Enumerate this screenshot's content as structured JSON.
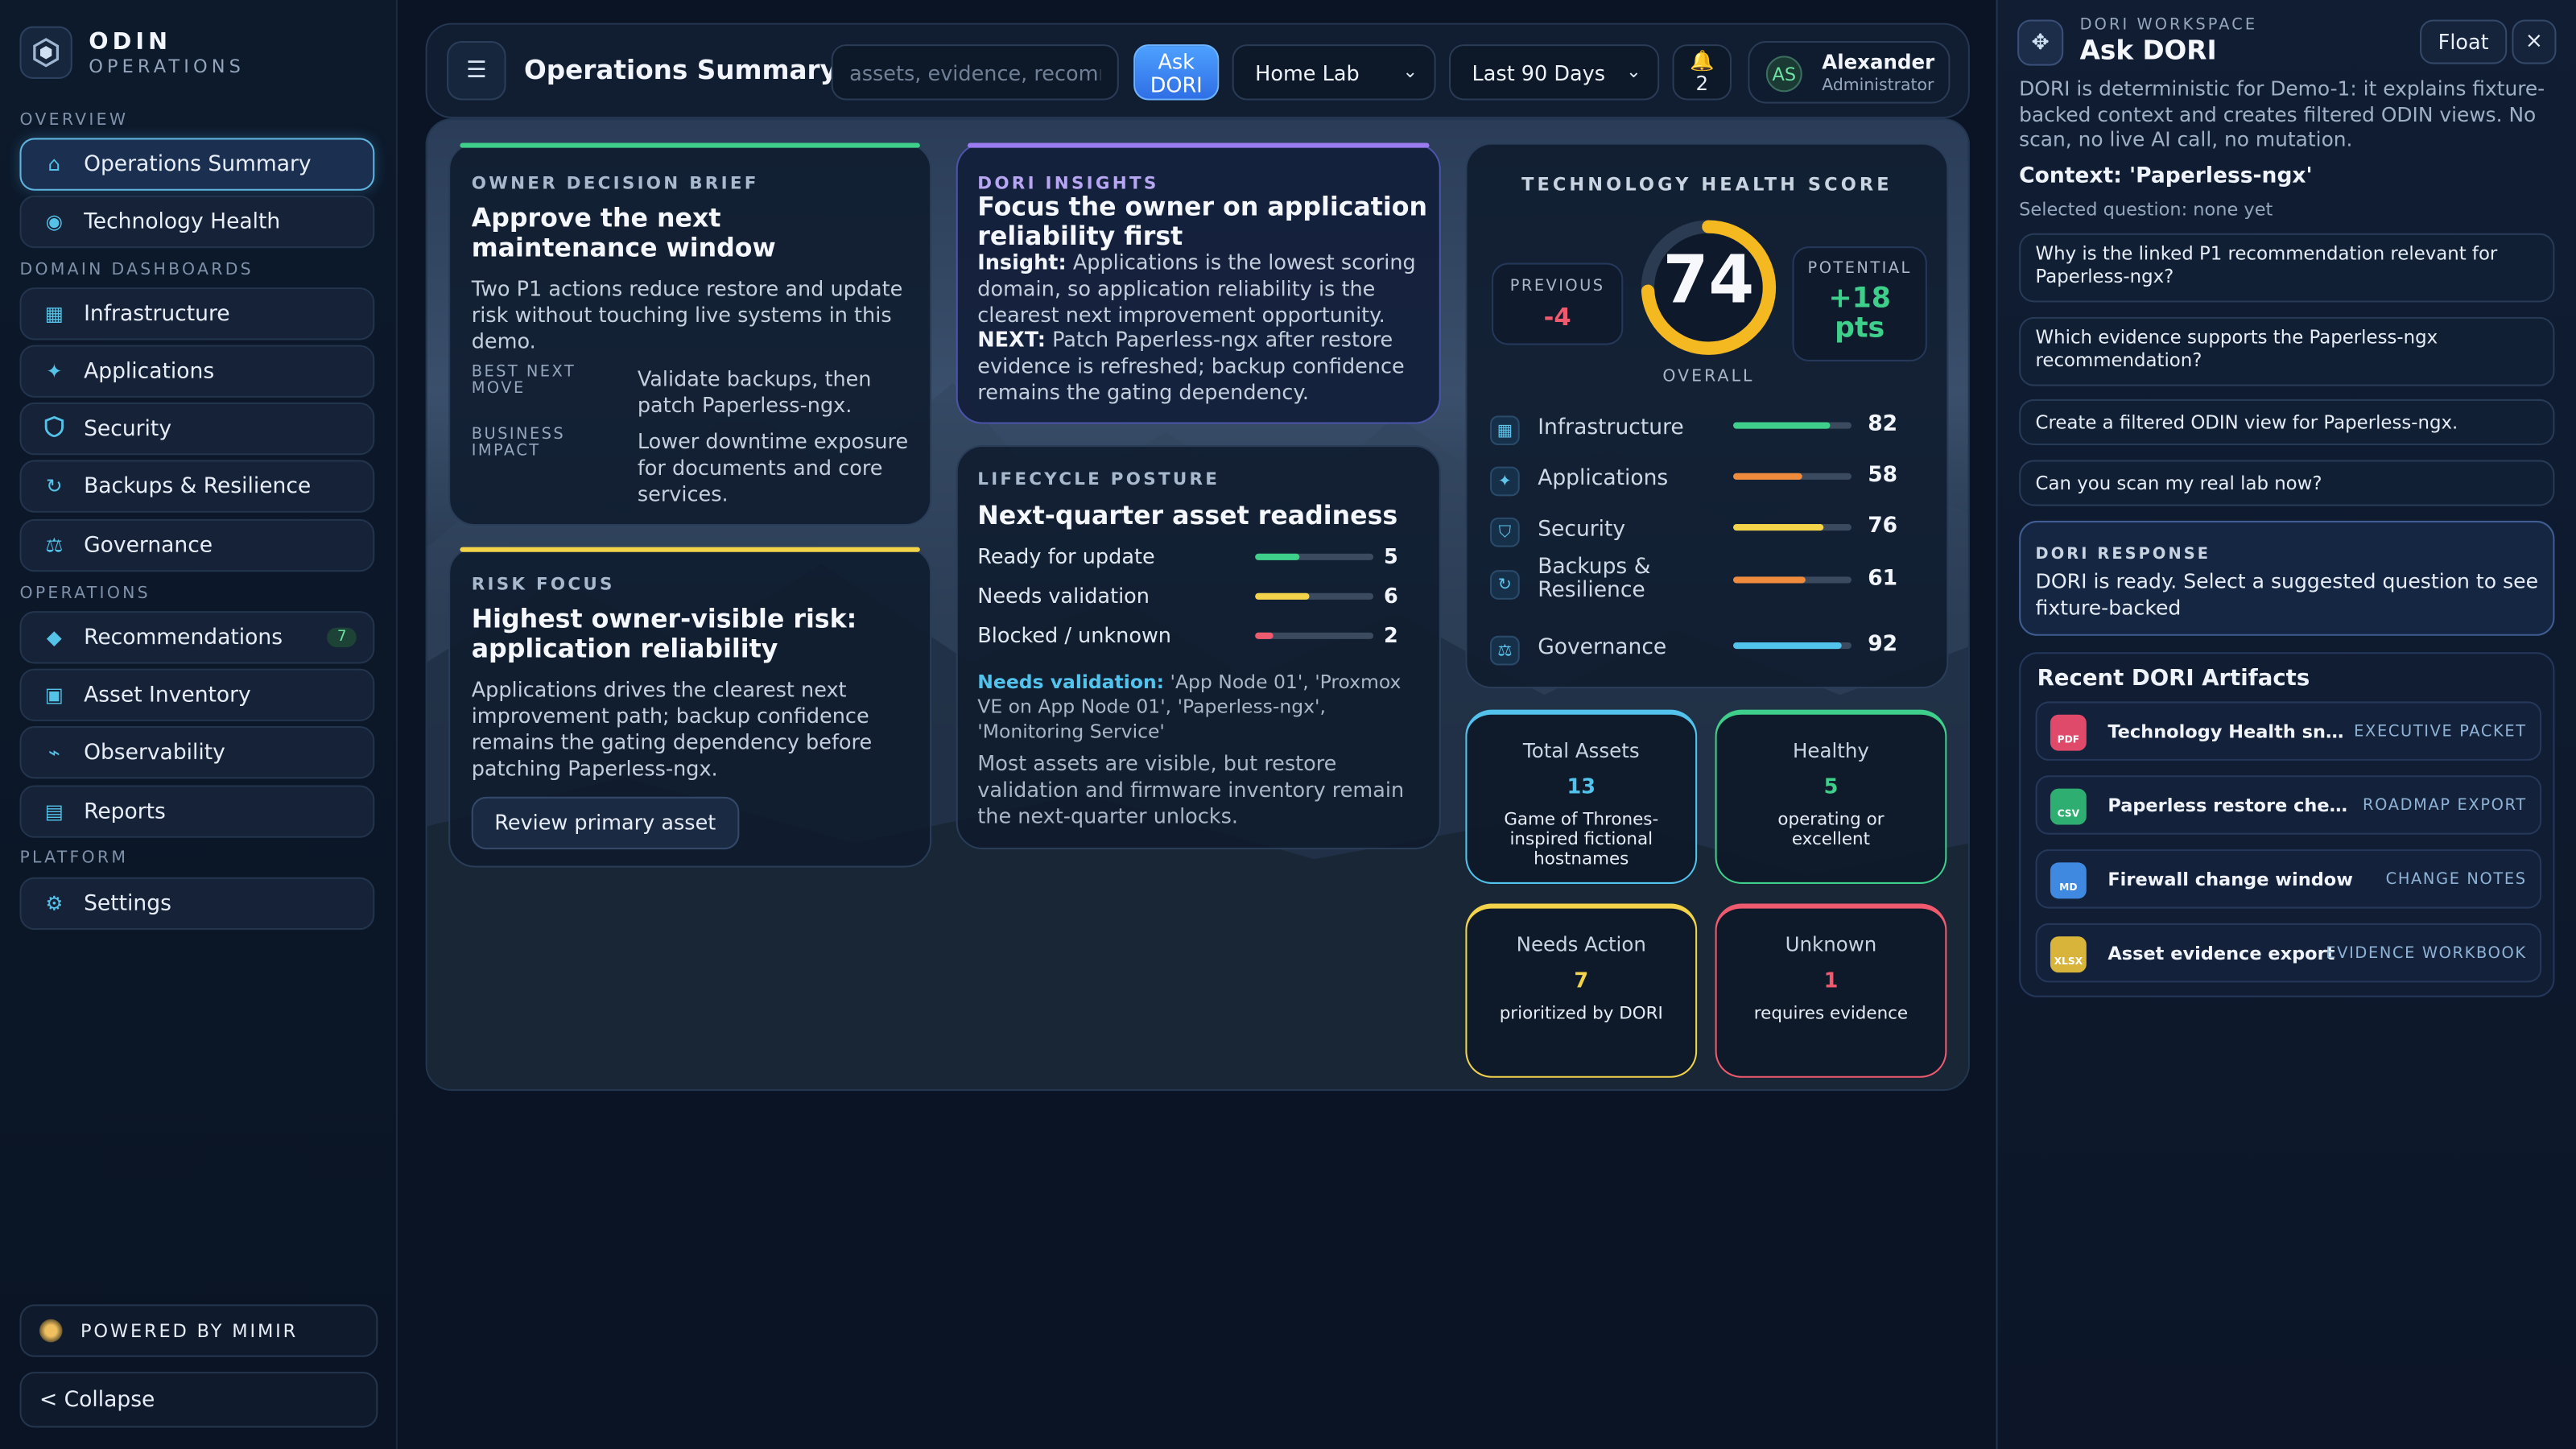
{
  "brand": {
    "name": "ODIN",
    "sub": "OPERATIONS"
  },
  "sections": {
    "overview": "OVERVIEW",
    "domain": "DOMAIN DASHBOARDS",
    "operations": "OPERATIONS",
    "platform": "PLATFORM"
  },
  "nav": {
    "overview": [
      {
        "label": "Operations Summary",
        "icon": "home-icon"
      },
      {
        "label": "Technology Health",
        "icon": "pulse-icon"
      }
    ],
    "domain": [
      {
        "label": "Infrastructure",
        "icon": "server-icon"
      },
      {
        "label": "Applications",
        "icon": "sparkle-icon"
      },
      {
        "label": "Security",
        "icon": "shield-icon"
      },
      {
        "label": "Backups & Resilience",
        "icon": "refresh-icon"
      },
      {
        "label": "Governance",
        "icon": "scale-icon"
      }
    ],
    "operations": [
      {
        "label": "Recommendations",
        "icon": "diamond-icon",
        "badge": "7"
      },
      {
        "label": "Asset Inventory",
        "icon": "box-icon"
      },
      {
        "label": "Observability",
        "icon": "wave-icon"
      },
      {
        "label": "Reports",
        "icon": "report-icon"
      }
    ],
    "platform": [
      {
        "label": "Settings",
        "icon": "gear-icon"
      }
    ]
  },
  "powered": "POWERED BY MIMIR",
  "collapse": "< Collapse",
  "header": {
    "title": "Operations Summary",
    "search_placeholder": "assets, evidence, recommendations",
    "ask_line1": "Ask",
    "ask_line2": "DORI",
    "site": "Home Lab",
    "range": "Last 90 Days",
    "bell_count": "2",
    "user_initials": "AS",
    "user_name": "Alexander",
    "user_role": "Administrator"
  },
  "owner": {
    "kicker": "OWNER DECISION BRIEF",
    "title": "Approve the next maintenance window",
    "text": "Two P1 actions reduce restore and update risk without touching live systems in this demo.",
    "k1": "BEST NEXT MOVE",
    "v1": "Validate backups, then patch Paperless-ngx.",
    "k2": "BUSINESS IMPACT",
    "v2": "Lower downtime exposure for documents and core services."
  },
  "risk": {
    "kicker": "RISK FOCUS",
    "title": "Highest owner-visible risk: application reliability",
    "text": "Applications drives the clearest next improvement path; backup confidence remains the gating dependency before patching Paperless-ngx.",
    "button": "Review primary asset"
  },
  "insights": {
    "kicker": "DORI INSIGHTS",
    "title": "Focus the owner on application reliability first",
    "insight_label": "Insight:",
    "insight": "Applications is the lowest scoring domain, so application reliability is the clearest next improvement opportunity.",
    "next_label": "NEXT:",
    "next": "Patch Paperless-ngx after restore evidence is refreshed; backup confidence remains the gating dependency."
  },
  "lifecycle": {
    "kicker": "LIFECYCLE POSTURE",
    "title": "Next-quarter asset readiness",
    "rows": [
      {
        "label": "Ready for update",
        "value": "5",
        "fraction": 0.38,
        "color": "#3ed08a"
      },
      {
        "label": "Needs validation",
        "value": "6",
        "fraction": 0.46,
        "color": "#f2d34a"
      },
      {
        "label": "Blocked / unknown",
        "value": "2",
        "fraction": 0.15,
        "color": "#ef5a6f"
      }
    ],
    "nv_label": "Needs validation:",
    "nv_text": "'App Node 01', 'Proxmox VE on App Node 01', 'Paperless-ngx', 'Monitoring Service'",
    "note": "Most assets are visible, but restore validation and firmware inventory remain the next-quarter unlocks."
  },
  "health": {
    "kicker": "TECHNOLOGY HEALTH SCORE",
    "score": "74",
    "score_fraction": 0.74,
    "overall": "OVERALL",
    "prev_label": "PREVIOUS",
    "prev": "-4",
    "pot_label": "POTENTIAL",
    "pot": "+18",
    "pot_unit": "pts",
    "domains": [
      {
        "name": "Infrastructure",
        "value": "82",
        "fraction": 0.82,
        "color": "#3ed08a",
        "icon": "server-icon"
      },
      {
        "name": "Applications",
        "value": "58",
        "fraction": 0.58,
        "color": "#f08a3c",
        "icon": "sparkle-icon"
      },
      {
        "name": "Security",
        "value": "76",
        "fraction": 0.76,
        "color": "#f2d34a",
        "icon": "shield-icon"
      },
      {
        "name": "Backups & Resilience",
        "value": "61",
        "fraction": 0.61,
        "color": "#f08a3c",
        "icon": "refresh-icon"
      },
      {
        "name": "Governance",
        "value": "92",
        "fraction": 0.92,
        "color": "#52c3ec",
        "icon": "scale-icon"
      }
    ]
  },
  "stats": [
    {
      "label": "Total Assets",
      "value": "13",
      "desc": "Game of Thrones-inspired fictional hostnames",
      "color": "#52c3ec",
      "vcolor": "#52c3ec"
    },
    {
      "label": "Healthy",
      "value": "5",
      "desc": "operating or excellent",
      "color": "#3ed08a",
      "vcolor": "#3ed08a"
    },
    {
      "label": "Needs Action",
      "value": "7",
      "desc": "prioritized by DORI",
      "color": "#f2d34a",
      "vcolor": "#f2d34a"
    },
    {
      "label": "Unknown",
      "value": "1",
      "desc": "requires evidence",
      "color": "#ef5a6f",
      "vcolor": "#ef5a6f"
    }
  ],
  "dori": {
    "kicker": "DORI WORKSPACE",
    "title": "Ask DORI",
    "float": "Float",
    "close": "×",
    "intro": "DORI is deterministic for Demo-1: it explains fixture-backed context and creates filtered ODIN views. No scan, no live AI call, no mutation.",
    "context": "Context: 'Paperless-ngx'",
    "selected": "Selected question: none yet",
    "questions": [
      "Why is the linked P1 recommendation relevant for Paperless-ngx?",
      "Which evidence supports the Paperless-ngx recommendation?",
      "Create a filtered ODIN view for Paperless-ngx.",
      "Can you scan my real lab now?"
    ],
    "response_kicker": "DORI RESPONSE",
    "response": "DORI is ready. Select a suggested question to see fixture-backed",
    "artifacts_title": "Recent DORI Artifacts",
    "artifacts": [
      {
        "name": "Technology Health snapshot",
        "type": "EXECUTIVE PACKET",
        "ext": "PDF",
        "color": "#e04a6a"
      },
      {
        "name": "Paperless restore checklist",
        "type": "ROADMAP EXPORT",
        "ext": "CSV",
        "color": "#2fae72"
      },
      {
        "name": "Firewall change window",
        "type": "CHANGE NOTES",
        "ext": "MD",
        "color": "#3f8ae0"
      },
      {
        "name": "Asset evidence export",
        "type": "EVIDENCE WORKBOOK",
        "ext": "XLSX",
        "color": "#d8b53a"
      }
    ]
  }
}
